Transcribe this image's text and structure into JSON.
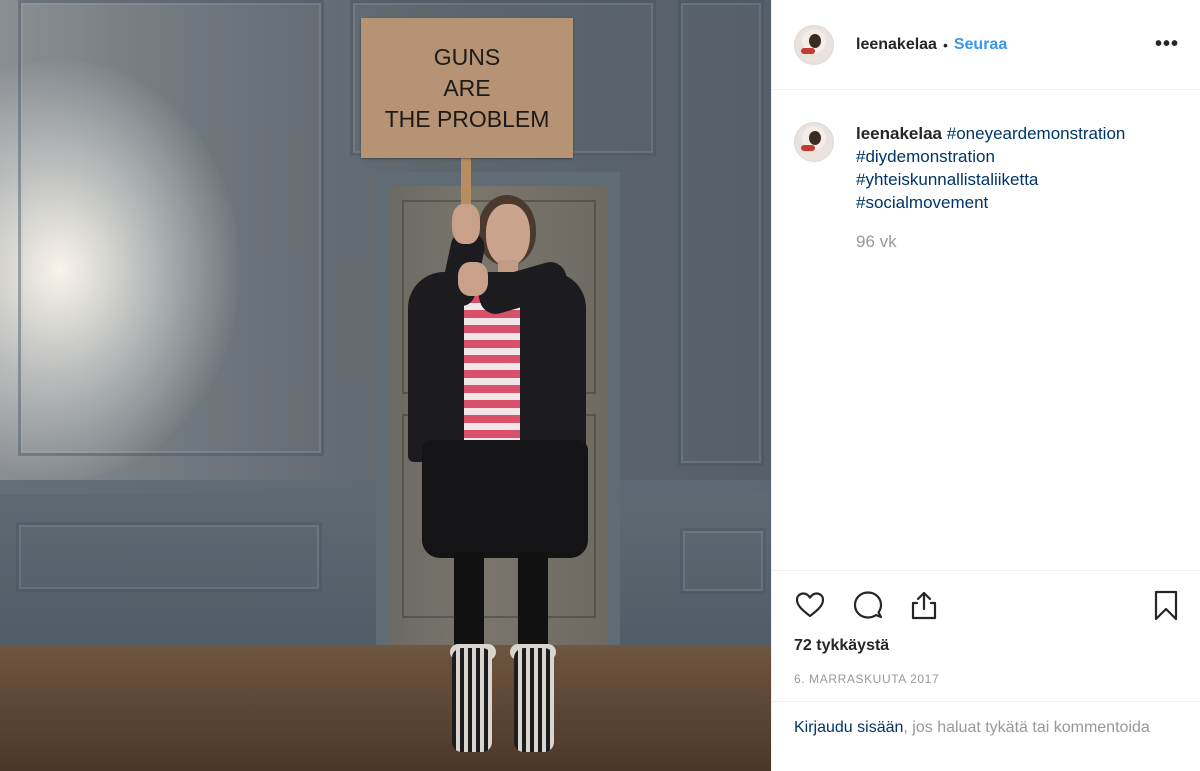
{
  "photo": {
    "sign_lines": [
      "GUNS",
      "ARE",
      "THE PROBLEM"
    ]
  },
  "header": {
    "username": "leenakelaa",
    "separator": "•",
    "follow_label": "Seuraa",
    "more_label": "•••"
  },
  "caption": {
    "username": "leenakelaa",
    "hashtags": [
      "#oneyeardemonstration",
      "#diydemonstration",
      "#yhteiskunnallistaliiketta",
      "#socialmovement"
    ],
    "time_ago": "96 vk"
  },
  "actions": {
    "icons": [
      "heart-icon",
      "comment-icon",
      "share-icon",
      "bookmark-icon"
    ],
    "likes": "72 tykkäystä",
    "date": "6. MARRASKUUTA 2017"
  },
  "login": {
    "link_text": "Kirjaudu sisään",
    "rest_text": ", jos haluat tykätä tai kommentoida"
  },
  "colors": {
    "link_blue": "#3897f0",
    "hashtag": "#003569",
    "muted": "#999999",
    "sign": "#b59374"
  }
}
